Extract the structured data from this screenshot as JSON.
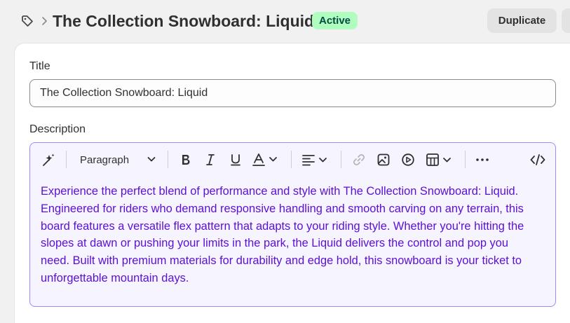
{
  "header": {
    "breadcrumb_icon": "tag-icon",
    "title": "The Collection Snowboard: Liquid",
    "status": "Active",
    "duplicate_label": "Duplicate"
  },
  "form": {
    "title_label": "Title",
    "title_value": "The Collection Snowboard: Liquid",
    "description_label": "Description",
    "toolbar": {
      "block_format": "Paragraph",
      "icons": [
        "magic-icon",
        "bold-icon",
        "italic-icon",
        "underline-icon",
        "text-color-icon",
        "align-icon",
        "link-icon",
        "image-icon",
        "video-icon",
        "table-icon",
        "more-icon",
        "code-icon"
      ]
    },
    "description_text": "Experience the perfect blend of performance and style with The Collection Snowboard: Liquid. Engineered for riders who demand responsive handling and smooth carving on any terrain, this board features a versatile flex pattern that adapts to your riding style. Whether you're hitting the slopes at dawn or pushing your limits in the park, the Liquid delivers the control and pop you need. Built with premium materials for durability and edge hold, this snowboard is your ticket to unforgettable mountain days."
  },
  "colors": {
    "badge_bg": "#affebf",
    "badge_text": "#014b40",
    "editor_border": "#9c8cf5",
    "editor_text": "#5b0fd4"
  }
}
